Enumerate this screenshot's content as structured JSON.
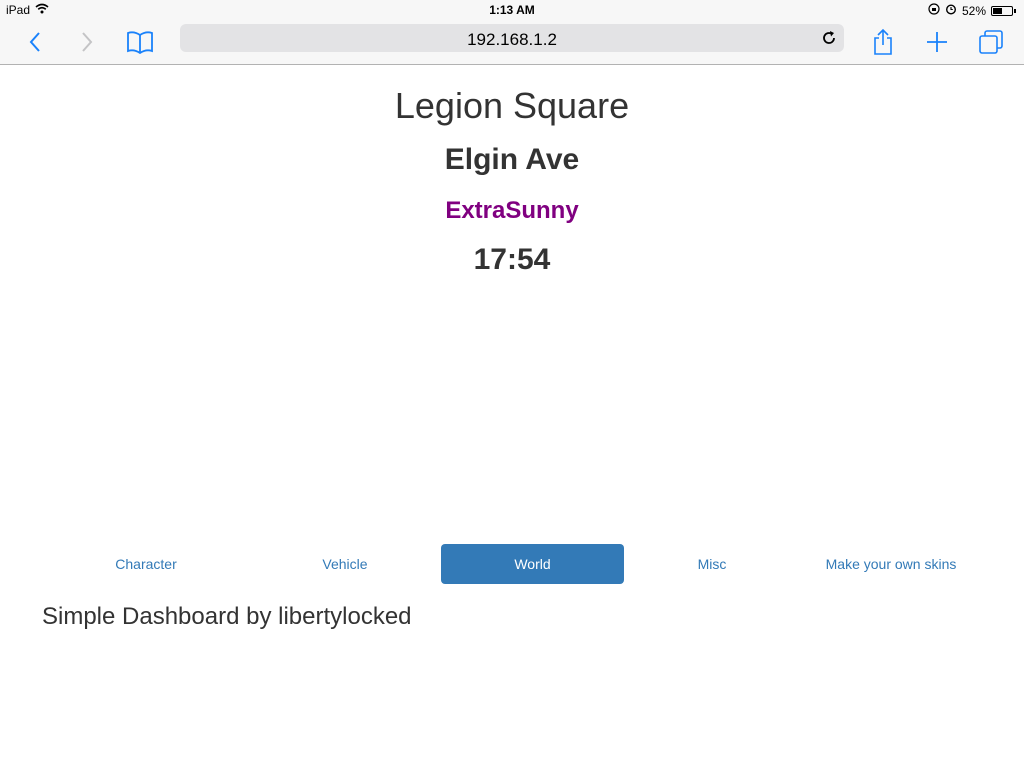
{
  "statusbar": {
    "device": "iPad",
    "time": "1:13 AM",
    "battery_percent": "52%",
    "battery_level": 0.52,
    "icons": [
      "wifi-icon",
      "orientation-lock-icon",
      "alarm-icon",
      "battery-icon"
    ]
  },
  "toolbar": {
    "url": "192.168.1.2",
    "icons": [
      "back-icon",
      "forward-icon",
      "bookmarks-icon",
      "reload-icon",
      "share-icon",
      "add-icon",
      "tabs-icon"
    ],
    "accent": "#1a82fb"
  },
  "main": {
    "zone": "Legion Square",
    "street": "Elgin Ave",
    "weather": "ExtraSunny",
    "weather_color": "#800080",
    "time": "17:54"
  },
  "tabs": [
    {
      "label": "Character",
      "active": false
    },
    {
      "label": "Vehicle",
      "active": false
    },
    {
      "label": "World",
      "active": true
    },
    {
      "label": "Misc",
      "active": false
    },
    {
      "label": "Make your own skins",
      "active": false
    }
  ],
  "footer": {
    "title": "Simple Dashboard by libertylocked"
  },
  "colors": {
    "link": "#337ab7",
    "active_tab_bg": "#337ab7",
    "text": "#333333"
  }
}
